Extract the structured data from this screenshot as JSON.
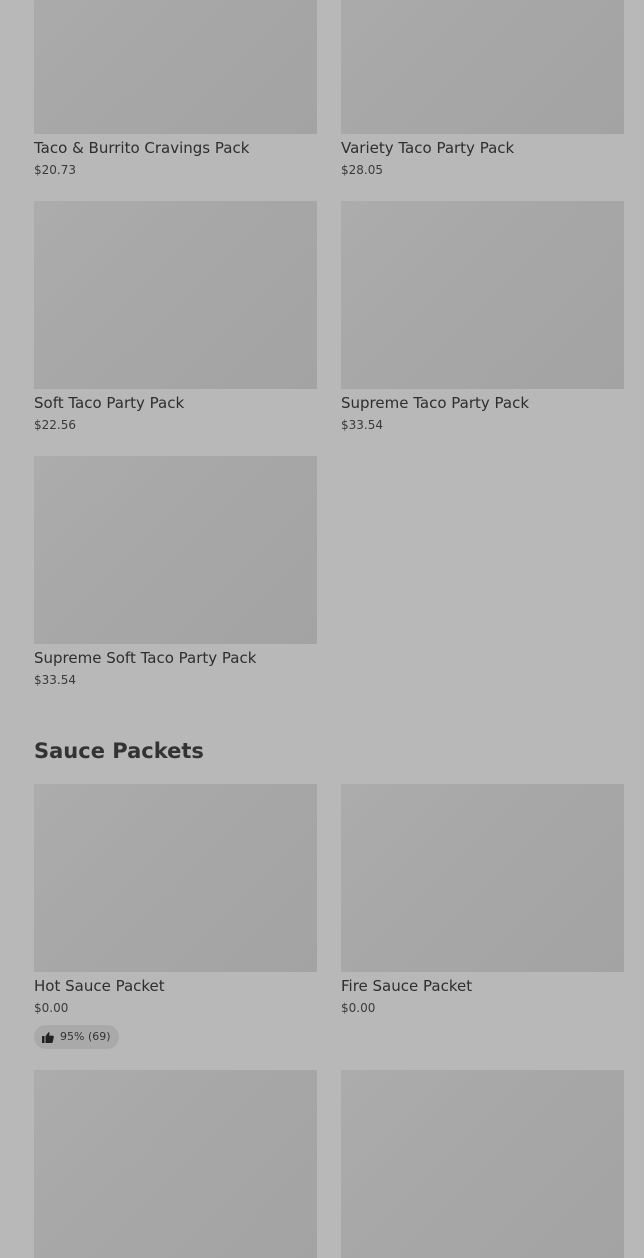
{
  "section1": {
    "items": [
      {
        "name": "Taco & Burrito Cravings Pack",
        "price": "$20.73"
      },
      {
        "name": "Variety Taco Party Pack",
        "price": "$28.05"
      },
      {
        "name": "Soft Taco Party Pack",
        "price": "$22.56"
      },
      {
        "name": "Supreme Taco Party Pack",
        "price": "$33.54"
      },
      {
        "name": "Supreme Soft Taco Party Pack",
        "price": "$33.54"
      }
    ]
  },
  "sauce": {
    "title": "Sauce Packets",
    "items": [
      {
        "name": "Hot Sauce Packet",
        "price": "$0.00",
        "rating": "95% (69)",
        "rating_icon": "thumbs-up-icon"
      },
      {
        "name": "Fire Sauce Packet",
        "price": "$0.00"
      }
    ]
  },
  "colors": {
    "background": "#b8b8b8",
    "thumbnail": "#a8a8a8",
    "text": "#2b2b2b"
  }
}
